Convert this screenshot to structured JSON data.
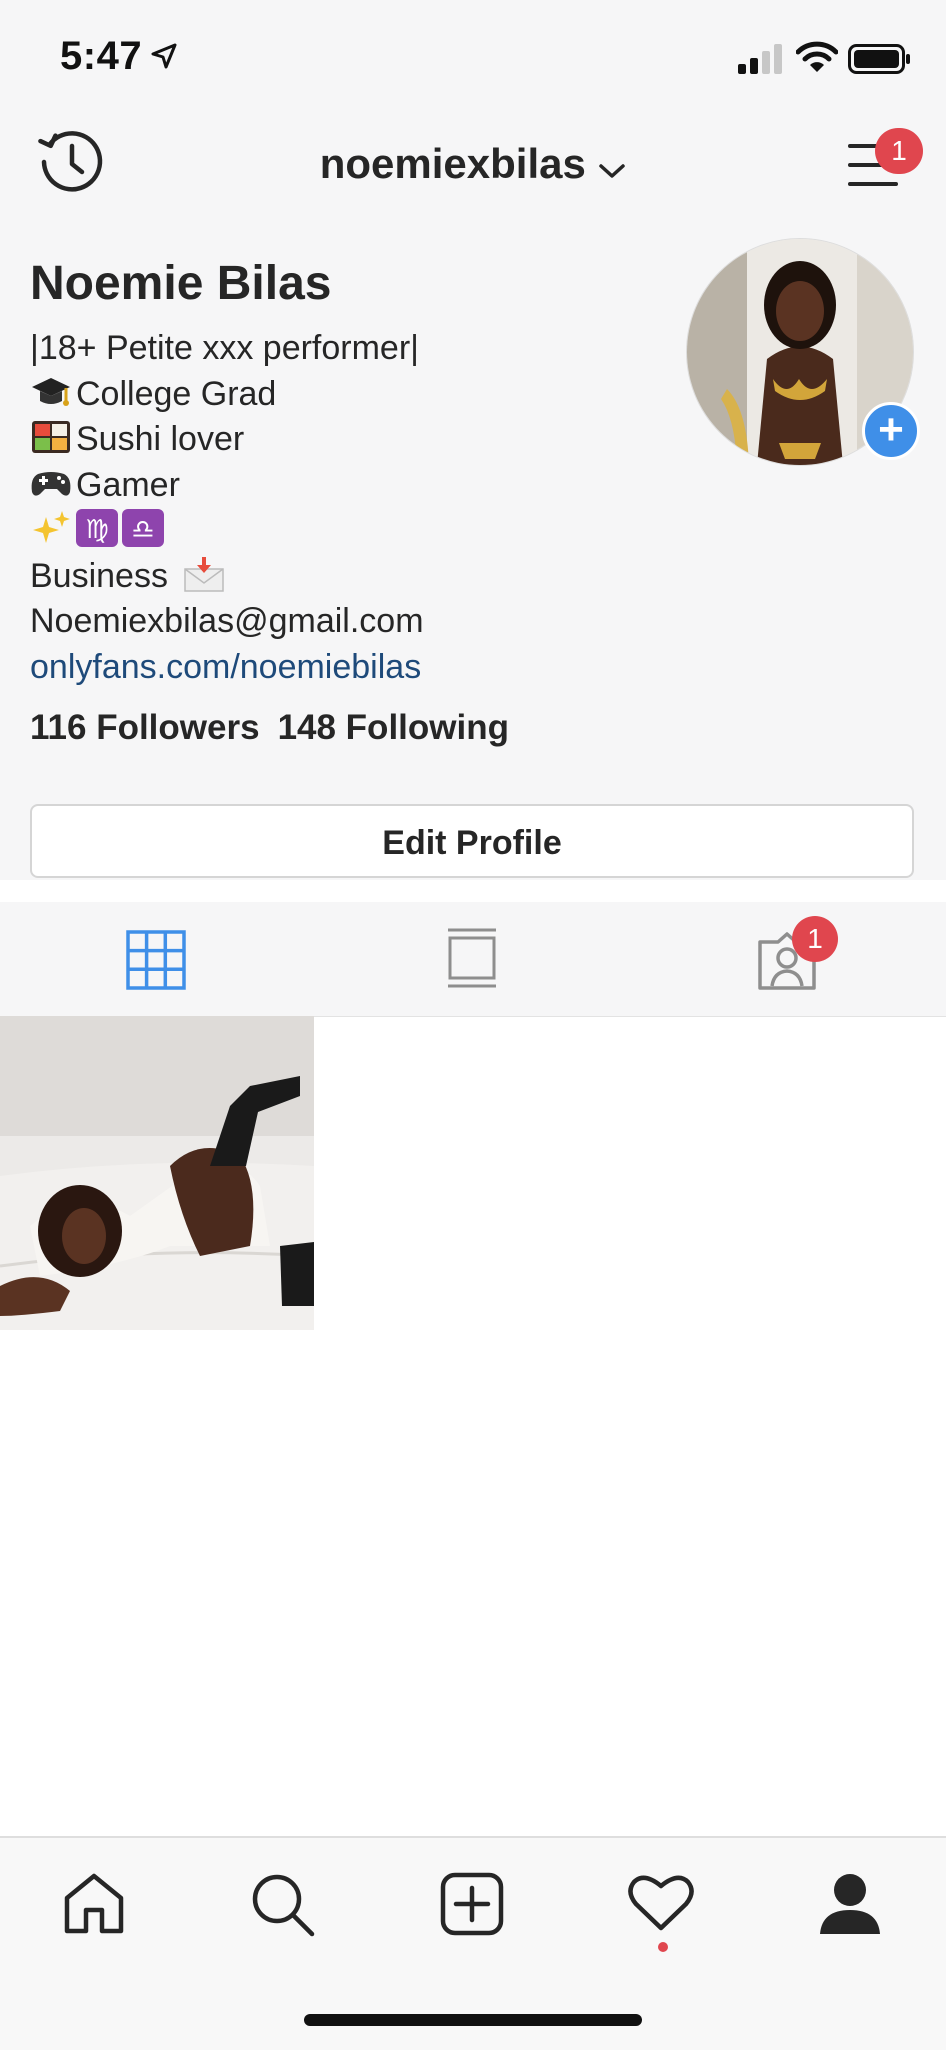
{
  "status_bar": {
    "time": "5:47"
  },
  "header": {
    "username": "noemiexbilas",
    "menu_badge": "1"
  },
  "profile": {
    "display_name": "Noemie Bilas",
    "bio_lines": [
      {
        "emoji": "",
        "text": "|18+ Petite xxx performer|"
      },
      {
        "emoji": "graduation-cap",
        "text": "College Grad"
      },
      {
        "emoji": "bento-box",
        "text": "Sushi lover"
      },
      {
        "emoji": "game-controller",
        "text": "Gamer"
      },
      {
        "emoji": "sparkles-virgo-libra",
        "text": ""
      },
      {
        "emoji": "",
        "text": "Business"
      },
      {
        "emoji": "",
        "text": "Noemiexbilas@gmail.com"
      }
    ],
    "link": "onlyfans.com/noemiebilas",
    "followers": "116 Followers",
    "following": "148 Following",
    "edit_button": "Edit Profile"
  },
  "tabs": {
    "tagged_badge": "1"
  },
  "colors": {
    "accent_blue": "#3f8fe8",
    "badge_red": "#e0464e",
    "link_blue": "#1e4a7a"
  }
}
